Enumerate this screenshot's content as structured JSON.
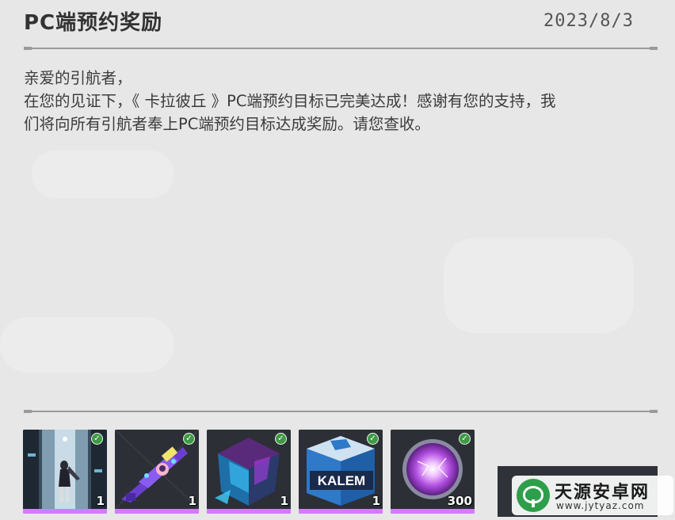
{
  "mail": {
    "title": "PC端预约奖励",
    "date": "2023/8/3",
    "greeting": "亲爱的引航者，",
    "body_line1": "在您的见证下，《 卡拉彼丘 》PC端预约目标已完美达成！感谢有您的支持，我",
    "body_line2": "们将向所有引航者奉上PC端预约目标达成奖励。请您查收。"
  },
  "rewards": [
    {
      "icon": "character-card-icon",
      "count": "1",
      "claimed": true
    },
    {
      "icon": "weapon-skin-icon",
      "count": "1",
      "claimed": true
    },
    {
      "icon": "hex-crate-icon",
      "count": "1",
      "claimed": true
    },
    {
      "icon": "kalem-box-icon",
      "count": "1",
      "claimed": true
    },
    {
      "icon": "energy-orb-icon",
      "count": "300",
      "claimed": true
    }
  ],
  "watermark": {
    "title": "天源安卓网",
    "url": "www.jytyaz.com"
  },
  "colors": {
    "background": "#e7e7e7",
    "rarity_bar": "#d37bff",
    "claimed_check": "#3f9a45",
    "claim_button": "#2f3238"
  }
}
